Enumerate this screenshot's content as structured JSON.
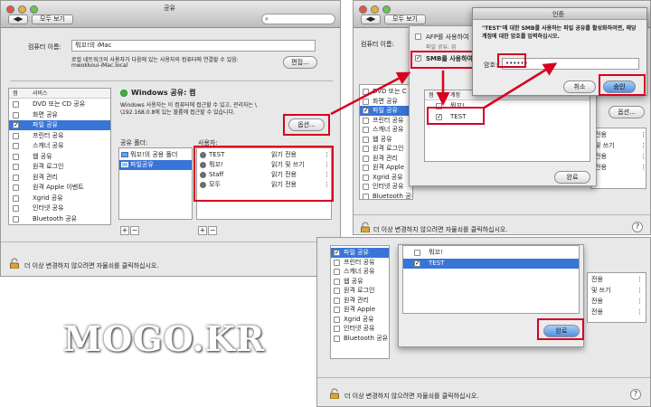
{
  "win1": {
    "title": "공유",
    "show_all": "모두 보기",
    "computer_name_label": "컴퓨터 이름:",
    "computer_name_value": "뭐꼬!의 iMac",
    "local_desc": "로컬 네트워크의 사용자가 다음에 있는 사용자의 컴퓨터에 연결할 수 있음:",
    "local_host": "mwokkoui-iMac.local",
    "edit_button": "편집...",
    "service_header_on": "켬",
    "service_header": "서비스",
    "services": [
      {
        "label": "DVD 또는 CD 공유",
        "checked": false
      },
      {
        "label": "화면 공유",
        "checked": false
      },
      {
        "label": "파일 공유",
        "checked": true
      },
      {
        "label": "프린터 공유",
        "checked": false
      },
      {
        "label": "스캐너 공유",
        "checked": false
      },
      {
        "label": "웹 공유",
        "checked": false
      },
      {
        "label": "원격 로그인",
        "checked": false
      },
      {
        "label": "원격 관리",
        "checked": false
      },
      {
        "label": "원격 Apple 이벤트",
        "checked": false
      },
      {
        "label": "Xgrid 공유",
        "checked": false
      },
      {
        "label": "인터넷 공유",
        "checked": false
      },
      {
        "label": "Bluetooth 공유",
        "checked": false
      }
    ],
    "status_title": "Windows 공유: 켬",
    "status_desc1": "Windows 사용자는 이 컴퓨터에 접근할 수 있고, 관리자는 \\",
    "status_desc2": "\\192.168.0.8에 있는 볼륨에 접근할 수 있습니다.",
    "options_button": "옵션...",
    "folders_label": "공유 폴더:",
    "folders": [
      "뭐꼬!의 공용 폴더",
      "파일공유"
    ],
    "users_label": "사용자:",
    "users": [
      {
        "name": "TEST",
        "perm": "읽기 전용"
      },
      {
        "name": "뭐꼬!",
        "perm": "읽기 및 쓰기"
      },
      {
        "name": "Staff",
        "perm": "읽기 전용"
      },
      {
        "name": "모두",
        "perm": "읽기 전용"
      }
    ],
    "lock_text": "더 이상 변경하지 않으려면 자물쇠를 클릭하십시오.",
    "help": "?"
  },
  "win2": {
    "title": "공유",
    "show_all": "모두 보기",
    "computer_name_label": "컴퓨터 이름:",
    "edit_button": "편집...",
    "afp_label": "AFP를 사용하여",
    "smb_label": "SMB를 사용하여",
    "share_subhead": "파일 공유: 끔",
    "services_partial": [
      "DVD 또는 C",
      "화면 공유",
      "파일 공유",
      "프린터 공유",
      "스캐너 공유",
      "웹 공유",
      "원격 로그인",
      "원격 관리",
      "원격 Apple",
      "Xgrid 공유",
      "인터넷 공유",
      "Bluetooth 공유"
    ],
    "list_header": "켬",
    "list_header2": "계정",
    "list_items": [
      {
        "name": "뭐꼬!",
        "checked": false
      },
      {
        "name": "TEST",
        "checked": true
      }
    ],
    "done_button": "완료",
    "options_button": "옵션...",
    "perms": [
      "전용",
      "및 쓰기",
      "전용",
      "전용"
    ],
    "lock_text": "더 이상 변경하지 않으려면 자물쇠를 클릭하십시오.",
    "help": "?"
  },
  "auth_dialog": {
    "title": "인증",
    "message": "\"TEST\"에 대한 SMB를 사용하는 파일 공유를 활성화하려면, 해당 계정에 대한 암호를 입력하십시오.",
    "password_label": "암호:",
    "password_value": "••••••",
    "cancel_button": "취소",
    "ok_button": "승인"
  },
  "win3": {
    "services_partial": [
      "파일 공유",
      "프린터 공유",
      "스캐너 공유",
      "웹 공유",
      "원격 로그인",
      "원격 관리",
      "원격 Apple",
      "Xgrid 공유",
      "인터넷 공유",
      "Bluetooth 공유"
    ],
    "list_items": [
      {
        "name": "뭐꼬!",
        "checked": false
      },
      {
        "name": "TEST",
        "checked": true
      }
    ],
    "done_button": "완료",
    "perms": [
      "전용",
      "및 쓰기",
      "전용",
      "전용"
    ],
    "lock_text": "더 이상 변경하지 않으려면 자물쇠를 클릭하십시오.",
    "help": "?"
  },
  "watermark": "MOGO.KR",
  "colors": {
    "highlight": "#d8001f",
    "selection": "#3875d7"
  }
}
